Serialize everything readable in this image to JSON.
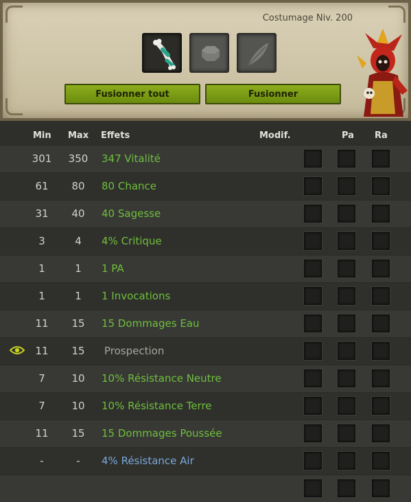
{
  "header": {
    "title": "Costumage Niv. 200",
    "slots": [
      {
        "icon": "bone-item-icon"
      },
      {
        "icon": "rune-slot-icon"
      },
      {
        "icon": "feather-slot-icon"
      }
    ],
    "buttons": {
      "merge_all": "Fusionner tout",
      "merge": "Fusionner"
    },
    "colors": {
      "button_green": "#7a9c14",
      "parchment": "#d2c9ad"
    }
  },
  "table": {
    "columns": {
      "min": "Min",
      "max": "Max",
      "effects": "Effets",
      "modif": "Modif.",
      "pa": "Pa",
      "ra": "Ra"
    },
    "rows": [
      {
        "min": "301",
        "max": "350",
        "effect": "347 Vitalité"
      },
      {
        "min": "61",
        "max": "80",
        "effect": "80 Chance"
      },
      {
        "min": "31",
        "max": "40",
        "effect": "40 Sagesse"
      },
      {
        "min": "3",
        "max": "4",
        "effect": "4% Critique"
      },
      {
        "min": "1",
        "max": "1",
        "effect": "1 PA"
      },
      {
        "min": "1",
        "max": "1",
        "effect": "1 Invocations"
      },
      {
        "min": "11",
        "max": "15",
        "effect": "15 Dommages Eau"
      },
      {
        "min": "11",
        "max": "15",
        "effect": "Prospection"
      },
      {
        "min": "7",
        "max": "10",
        "effect": "10% Résistance Neutre"
      },
      {
        "min": "7",
        "max": "10",
        "effect": "10% Résistance Terre"
      },
      {
        "min": "11",
        "max": "15",
        "effect": "15 Dommages Poussée"
      },
      {
        "min": "-",
        "max": "-",
        "effect": "4% Résistance Air"
      },
      {
        "min": "",
        "max": "",
        "effect": ""
      }
    ],
    "colors": {
      "effect_green": "#6fbf3c",
      "effect_grey": "#a6a6a0",
      "effect_blue": "#7aa7d8",
      "eye_yellow": "#c8d21e"
    }
  }
}
